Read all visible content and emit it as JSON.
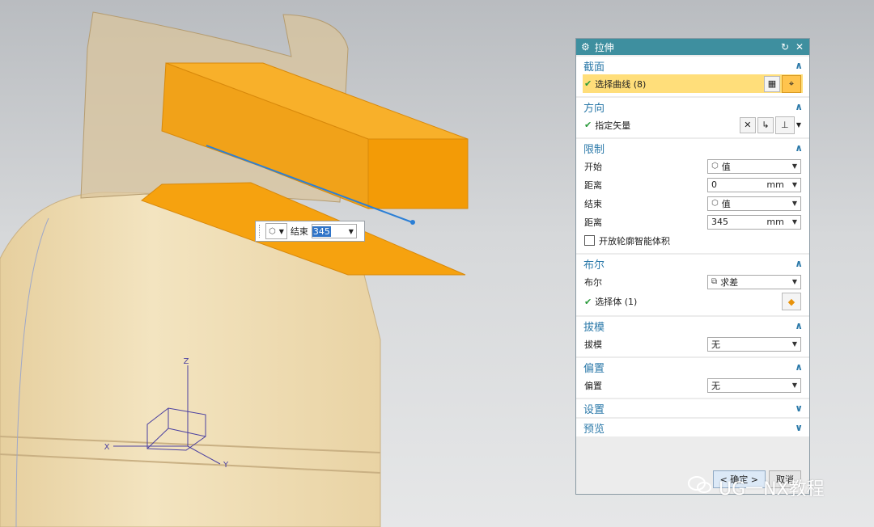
{
  "dialog": {
    "title": "拉伸",
    "sections": {
      "section": {
        "label": "截面",
        "row": {
          "label": "选择曲线 (8)"
        }
      },
      "direction": {
        "label": "方向",
        "row": {
          "label": "指定矢量"
        }
      },
      "limits": {
        "label": "限制",
        "rows": [
          {
            "label": "开始",
            "value": "值",
            "unit": ""
          },
          {
            "label": "距离",
            "value": "0",
            "unit": "mm"
          },
          {
            "label": "结束",
            "value": "值",
            "unit": ""
          },
          {
            "label": "距离",
            "value": "345",
            "unit": "mm"
          }
        ],
        "checkbox": "开放轮廓智能体积"
      },
      "boolean": {
        "label": "布尔",
        "row_label": "布尔",
        "value": "求差",
        "select_body": "选择体 (1)"
      },
      "draft": {
        "label": "拔模",
        "row_label": "拔模",
        "value": "无"
      },
      "offset": {
        "label": "偏置",
        "row_label": "偏置",
        "value": "无"
      },
      "settings": {
        "label": "设置"
      },
      "preview": {
        "label": "预览"
      }
    },
    "buttons": {
      "ok": "< 确定 >",
      "cancel": "取消"
    }
  },
  "floating_input": {
    "label": "结束",
    "value": "345"
  },
  "axes": {
    "x": "X",
    "y": "Y",
    "z": "Z"
  },
  "watermark": "UG一NX教程",
  "colors": {
    "accent": "#3e8f9f",
    "highlight": "#ffde7a",
    "solid": "#f6a20f"
  }
}
